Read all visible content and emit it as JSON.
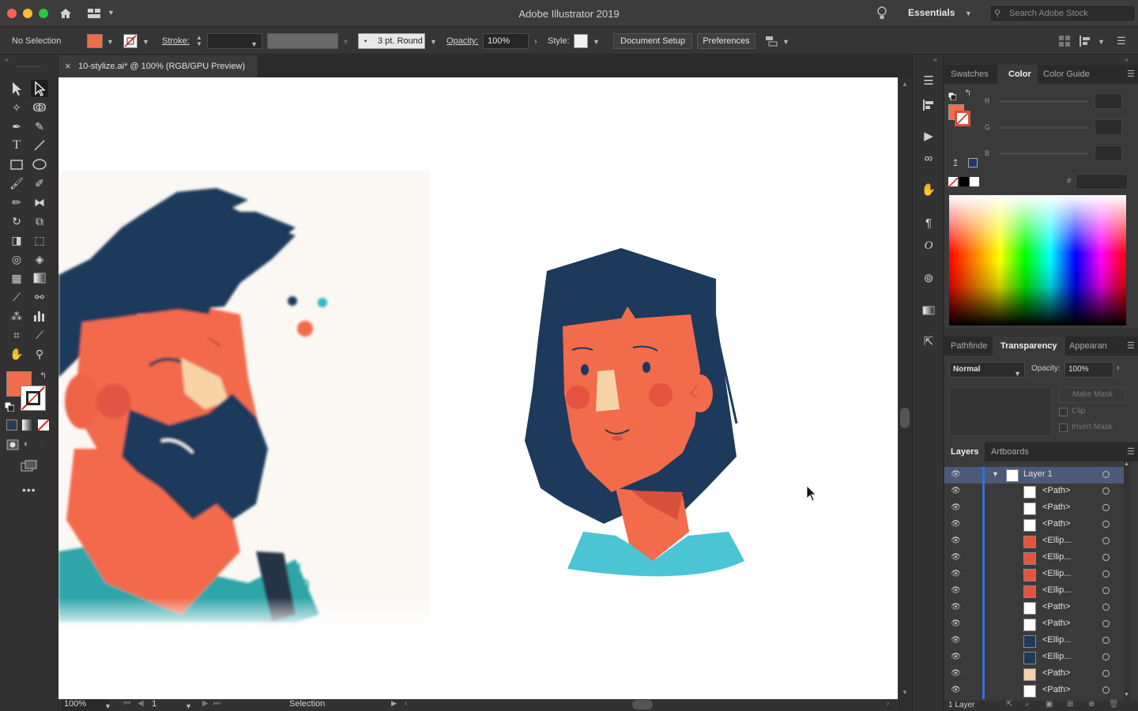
{
  "app": {
    "title": "Adobe Illustrator 2019",
    "workspace": "Essentials",
    "search_placeholder": "Search Adobe Stock"
  },
  "control_bar": {
    "selection_status": "No Selection",
    "stroke_label": "Stroke:",
    "brush_value": "3 pt. Round",
    "opacity_label": "Opacity:",
    "opacity_value": "100%",
    "style_label": "Style:",
    "document_setup_label": "Document Setup",
    "preferences_label": "Preferences"
  },
  "document": {
    "tab_title": "10-stylize.ai* @ 100% (RGB/GPU Preview)",
    "close_glyph": "×"
  },
  "status_bar": {
    "zoom": "100%",
    "artboard_number": "1",
    "current_tool": "Selection"
  },
  "color_panel": {
    "tabs": [
      "Swatches",
      "Color",
      "Color Guide"
    ],
    "active_tab": "Color",
    "channel_labels": [
      "R",
      "G",
      "B"
    ],
    "hex_label": "#",
    "fill_color": "#f26b4b"
  },
  "transparency_panel": {
    "tabs": [
      "Pathfinde",
      "Transparency",
      "Appearan"
    ],
    "active_tab": "Transparency",
    "blend_mode": "Normal",
    "opacity_label": "Opacity:",
    "opacity_value": "100%",
    "make_mask_label": "Make Mask",
    "clip_label": "Clip",
    "invert_mask_label": "Invert Mask"
  },
  "layers_panel": {
    "tabs": [
      "Layers",
      "Artboards"
    ],
    "active_tab": "Layers",
    "parent_layer": "Layer 1",
    "items": [
      {
        "name": "<Path>",
        "thumb": "#ffffff"
      },
      {
        "name": "<Path>",
        "thumb": "#ffffff"
      },
      {
        "name": "<Path>",
        "thumb": "#ffffff"
      },
      {
        "name": "<Ellip...",
        "thumb": "#e5523f"
      },
      {
        "name": "<Ellip...",
        "thumb": "#e5523f"
      },
      {
        "name": "<Ellip...",
        "thumb": "#e5523f"
      },
      {
        "name": "<Ellip...",
        "thumb": "#e5523f"
      },
      {
        "name": "<Path>",
        "thumb": "#ffffff"
      },
      {
        "name": "<Path>",
        "thumb": "#ffffff"
      },
      {
        "name": "<Ellip...",
        "thumb": "#1d3a5c"
      },
      {
        "name": "<Ellip...",
        "thumb": "#1d3a5c"
      },
      {
        "name": "<Path>",
        "thumb": "#f7d3a6"
      },
      {
        "name": "<Path>",
        "thumb": "#ffffff"
      }
    ],
    "footer_count": "1 Layer"
  },
  "colors": {
    "accent_blue": "#3b6fd6",
    "skin": "#f26b4b",
    "hair": "#1d3a5c",
    "shirt": "#4bc5d3",
    "nose": "#f7d3a6",
    "cheek": "#e5523f"
  }
}
